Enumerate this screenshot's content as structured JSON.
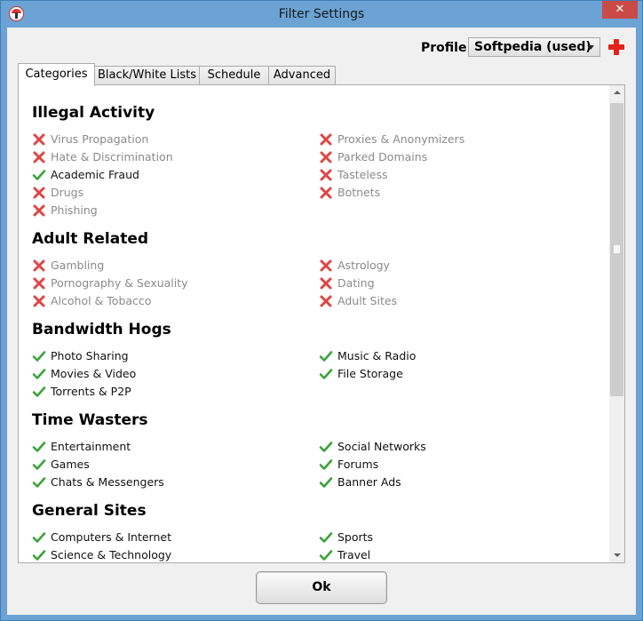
{
  "window": {
    "title": "Filter Settings",
    "close_glyph": "✕"
  },
  "profile": {
    "label": "Profile:",
    "selected": "Softpedia (used)"
  },
  "tabs": [
    "Categories",
    "Black/White Lists",
    "Schedule",
    "Advanced"
  ],
  "active_tab": "Categories",
  "status_colors": {
    "allowed": "#3aa339",
    "blocked": "#e04444"
  },
  "categories": [
    {
      "title": "Illegal Activity",
      "items": [
        {
          "label": "Virus Propagation",
          "allowed": false
        },
        {
          "label": "Proxies & Anonymizers",
          "allowed": false
        },
        {
          "label": "Hate & Discrimination",
          "allowed": false
        },
        {
          "label": "Parked Domains",
          "allowed": false
        },
        {
          "label": "Academic Fraud",
          "allowed": true
        },
        {
          "label": "Tasteless",
          "allowed": false
        },
        {
          "label": "Drugs",
          "allowed": false
        },
        {
          "label": "Botnets",
          "allowed": false
        },
        {
          "label": "Phishing",
          "allowed": false
        }
      ]
    },
    {
      "title": "Adult Related",
      "items": [
        {
          "label": "Gambling",
          "allowed": false
        },
        {
          "label": "Astrology",
          "allowed": false
        },
        {
          "label": "Pornography & Sexuality",
          "allowed": false
        },
        {
          "label": "Dating",
          "allowed": false
        },
        {
          "label": "Alcohol & Tobacco",
          "allowed": false
        },
        {
          "label": "Adult Sites",
          "allowed": false
        }
      ]
    },
    {
      "title": "Bandwidth Hogs",
      "items": [
        {
          "label": "Photo Sharing",
          "allowed": true
        },
        {
          "label": "Music & Radio",
          "allowed": true
        },
        {
          "label": "Movies & Video",
          "allowed": true
        },
        {
          "label": "File Storage",
          "allowed": true
        },
        {
          "label": "Torrents & P2P",
          "allowed": true
        }
      ]
    },
    {
      "title": "Time Wasters",
      "items": [
        {
          "label": "Entertainment",
          "allowed": true
        },
        {
          "label": "Social Networks",
          "allowed": true
        },
        {
          "label": "Games",
          "allowed": true
        },
        {
          "label": "Forums",
          "allowed": true
        },
        {
          "label": "Chats & Messengers",
          "allowed": true
        },
        {
          "label": "Banner Ads",
          "allowed": true
        }
      ]
    },
    {
      "title": "General Sites",
      "items": [
        {
          "label": "Computers & Internet",
          "allowed": true
        },
        {
          "label": "Sports",
          "allowed": true
        },
        {
          "label": "Science & Technology",
          "allowed": true
        },
        {
          "label": "Travel",
          "allowed": true
        }
      ]
    }
  ],
  "ok_button": "Ok"
}
